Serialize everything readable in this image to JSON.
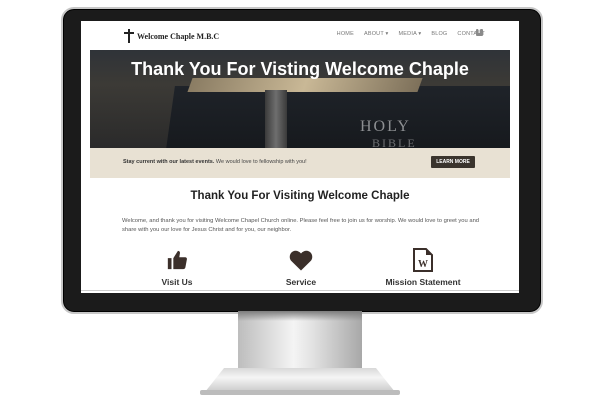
{
  "nav": {
    "logo_text": "Welcome Chaple M.B.C",
    "menu": [
      "HOME",
      "ABOUT ▾",
      "MEDIA ▾",
      "BLOG",
      "CONTACT"
    ],
    "fb": "f"
  },
  "hero": {
    "title": "Thank You For Visting Welcome Chaple",
    "book_word1": "HOLY",
    "book_word2": "BIBLE"
  },
  "banner": {
    "bold_text": "Stay current with our latest events.",
    "text": " We would love to fellowship with you!",
    "button_label": "LEARN MORE"
  },
  "content": {
    "title": "Thank You For Visiting Welcome Chaple",
    "paragraph": "Welcome, and thank you for visiting Welcome Chapel Church online. Please feel free to join us for worship. We would love to greet you and share with you our love for Jesus Christ and for you, our neighbor."
  },
  "features": [
    {
      "label": "Visit Us",
      "icon": "thumbs-up-icon"
    },
    {
      "label": "Service",
      "icon": "heart-icon"
    },
    {
      "label": "Mission Statement",
      "icon": "word-document-icon"
    }
  ],
  "colors": {
    "banner_bg": "#e8e1d3",
    "button_bg": "#3a342d",
    "icon_color": "#3b2f2a"
  }
}
